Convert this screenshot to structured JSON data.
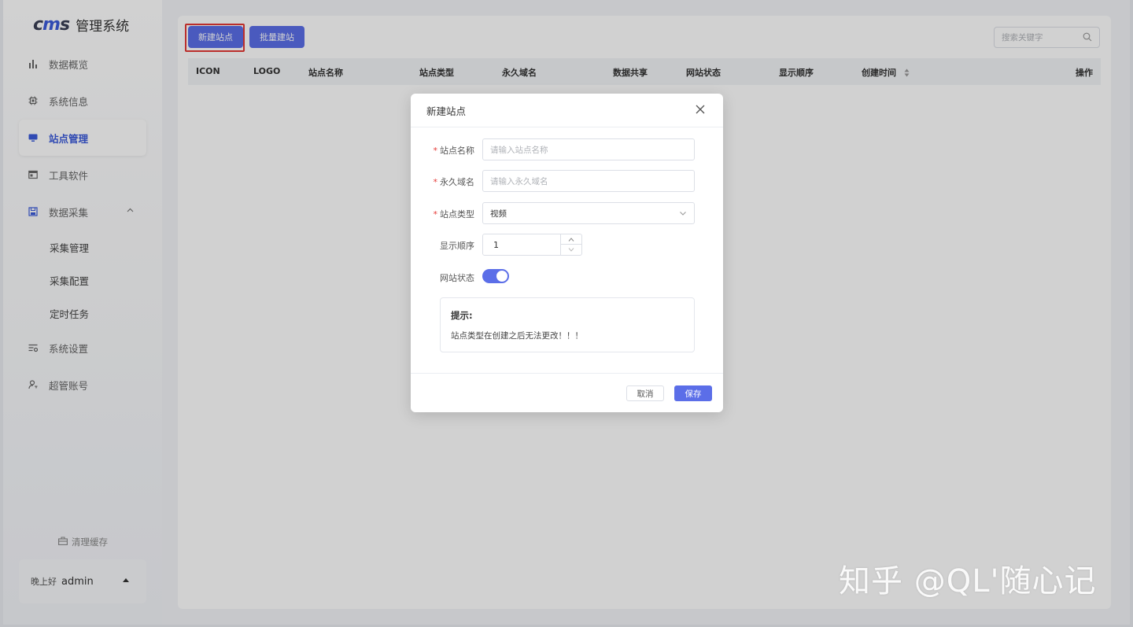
{
  "app": {
    "logo_mark": "cms",
    "logo_text": "管理系统"
  },
  "sidebar": {
    "items": [
      {
        "label": "数据概览",
        "icon": "bar-chart-icon"
      },
      {
        "label": "系统信息",
        "icon": "chip-icon"
      },
      {
        "label": "站点管理",
        "icon": "monitor-icon",
        "active": true
      },
      {
        "label": "工具软件",
        "icon": "window-icon"
      },
      {
        "label": "数据采集",
        "icon": "save-icon",
        "expanded": true
      }
    ],
    "sub_items": [
      {
        "label": "采集管理"
      },
      {
        "label": "采集配置"
      },
      {
        "label": "定时任务"
      }
    ],
    "items_after": [
      {
        "label": "系统设置",
        "icon": "settings-list-icon"
      },
      {
        "label": "超管账号",
        "icon": "user-key-icon"
      }
    ],
    "clear_cache": "清理缓存",
    "greeting": "晚上好",
    "username": "admin"
  },
  "toolbar": {
    "new_site_label": "新建站点",
    "batch_label": "批量建站",
    "search_placeholder": "搜索关键字"
  },
  "table": {
    "columns": [
      "ICON",
      "LOGO",
      "站点名称",
      "站点类型",
      "永久域名",
      "数据共享",
      "网站状态",
      "显示顺序",
      "创建时间",
      "操作"
    ]
  },
  "modal": {
    "title": "新建站点",
    "fields": {
      "name": {
        "label": "站点名称",
        "placeholder": "请输入站点名称",
        "required": true
      },
      "domain": {
        "label": "永久域名",
        "placeholder": "请输入永久域名",
        "required": true
      },
      "type": {
        "label": "站点类型",
        "value": "视频",
        "required": true
      },
      "order": {
        "label": "显示顺序",
        "value": "1"
      },
      "status": {
        "label": "网站状态",
        "enabled": true
      }
    },
    "tip_title": "提示:",
    "tip_text": "站点类型在创建之后无法更改！！！",
    "cancel_label": "取消",
    "save_label": "保存",
    "required_mark": "*"
  },
  "watermark": "知乎 @QL'随心记",
  "colors": {
    "primary": "#5b6ee8",
    "active_nav": "#3b5bdb",
    "highlight": "#e53935"
  }
}
